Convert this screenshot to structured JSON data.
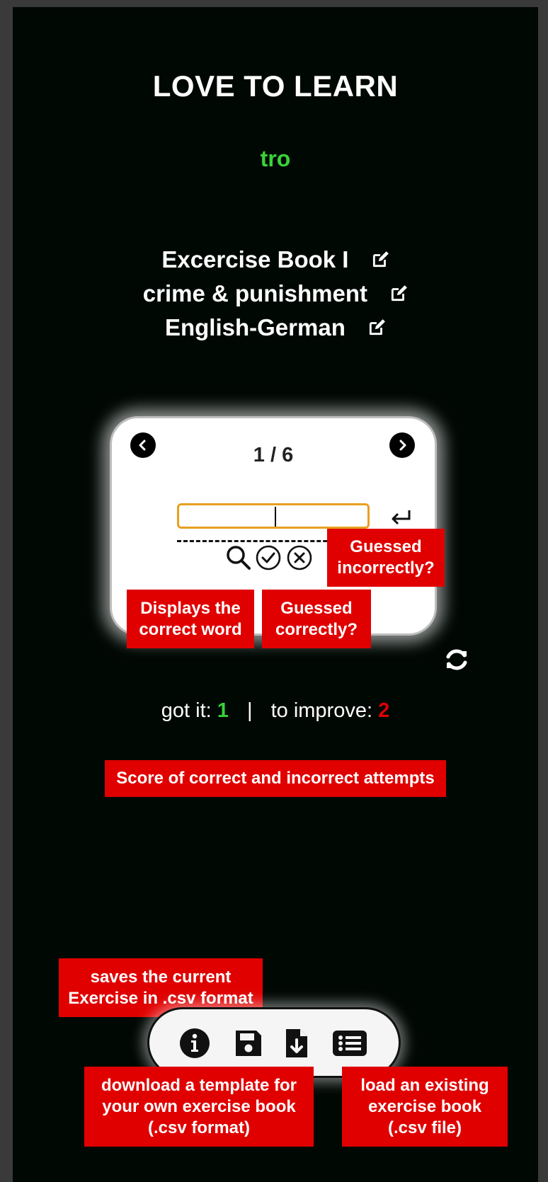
{
  "app": {
    "title": "LOVE TO LEARN",
    "subtitle": "tro"
  },
  "book": {
    "name": "Excercise Book I",
    "topic": "crime & punishment",
    "languages": "English-German"
  },
  "card": {
    "counter": "1 / 6",
    "answer_value": ""
  },
  "score": {
    "got_label": "got it:",
    "got_value": "1",
    "separator": "|",
    "improve_label": "to improve:",
    "improve_value": "2"
  },
  "tooltips": {
    "incorrect": "Guessed incorrectly?",
    "display_word": "Displays the correct word",
    "correct": "Guessed correctly?",
    "score": "Score of correct and incorrect attempts",
    "save": "saves the current Exercise in .csv format",
    "template": "download a template for your own exercise book (.csv format)",
    "load": "load an existing exercise book (.csv file)"
  },
  "colors": {
    "background": "#000804",
    "accent_green": "#38d238",
    "accent_red": "#e00000",
    "input_border": "#e8a020"
  },
  "icons": {
    "edit": "edit-icon",
    "prev": "chevron-left-icon",
    "next": "chevron-right-icon",
    "enter": "enter-icon",
    "search": "search-icon",
    "check": "check-circle-icon",
    "cross": "x-circle-icon",
    "refresh": "refresh-icon",
    "info": "info-icon",
    "save": "save-icon",
    "download": "file-download-icon",
    "list": "list-icon"
  }
}
